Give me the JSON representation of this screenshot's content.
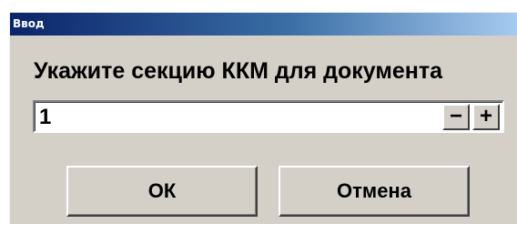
{
  "window": {
    "title": "Ввод"
  },
  "dialog": {
    "prompt": "Укажите секцию ККМ для документа",
    "input_value": "1",
    "decrement_label": "−",
    "increment_label": "+"
  },
  "buttons": {
    "ok_label": "ОК",
    "cancel_label": "Отмена"
  },
  "colors": {
    "title_gradient_start": "#0a246a",
    "title_gradient_end": "#a6caf0",
    "dialog_background": "#d4d0c8"
  }
}
